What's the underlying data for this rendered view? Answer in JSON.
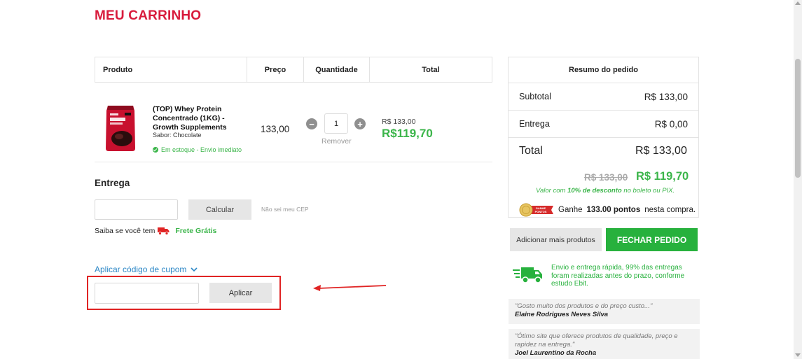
{
  "page": {
    "title": "MEU CARRINHO"
  },
  "cart": {
    "headers": {
      "product": "Produto",
      "price": "Preço",
      "quantity": "Quantidade",
      "total": "Total"
    },
    "items": [
      {
        "name": "(TOP) Whey Protein Concentrado (1KG) - Growth Supplements",
        "variant": "Sabor: Chocolate",
        "stock": "Em estoque - Envio imediato",
        "price": "133,00",
        "quantity": "1",
        "remove_label": "Remover",
        "old_total": "R$ 133,00",
        "total": "R$119,70",
        "image_icon": "whey-protein-package"
      }
    ]
  },
  "shipping": {
    "title": "Entrega",
    "cep_placeholder": "",
    "calc_label": "Calcular",
    "dont_know_cep": "Não sei meu CEP",
    "free_prefix": "Saiba se você tem",
    "free_label": "Frete Grátis"
  },
  "coupon": {
    "toggle_label": "Aplicar código de cupom",
    "placeholder": "",
    "apply_label": "Aplicar"
  },
  "summary": {
    "title": "Resumo do pedido",
    "subtotal_label": "Subtotal",
    "subtotal_value": "R$ 133,00",
    "delivery_label": "Entrega",
    "delivery_value": "R$ 0,00",
    "total_label": "Total",
    "total_value": "R$ 133,00",
    "old_price": "R$ 133,00",
    "discount_price": "R$ 119,70",
    "discount_text_prefix": "Valor com",
    "discount_text_bold": "10% de desconto",
    "discount_text_suffix": "no boleto ou PIX.",
    "points_badge": "GANHE PONTOS",
    "points_prefix": "Ganhe",
    "points_value": "133.00 pontos",
    "points_suffix": "nesta compra."
  },
  "actions": {
    "more_products": "Adicionar mais produtos",
    "checkout": "FECHAR PEDIDO"
  },
  "delivery_note": "Envio e entrega rápida, 99% das entregas foram realizadas antes do prazo, conforme estudo Ebit.",
  "reviews": [
    {
      "quote": "\"Gosto muito dos produtos e do preço custo...\"",
      "author": "Elaine Rodrigues Neves Silva"
    },
    {
      "quote": "\"Ótimo site que oferece produtos de qualidade, preço e rapidez na entrega.\"",
      "author": "Joel Laurentino da Rocha"
    }
  ],
  "colors": {
    "brand_red": "#d81b3c",
    "green": "#27b13d",
    "link_blue": "#2c87c6",
    "highlight_red": "#e02424"
  }
}
